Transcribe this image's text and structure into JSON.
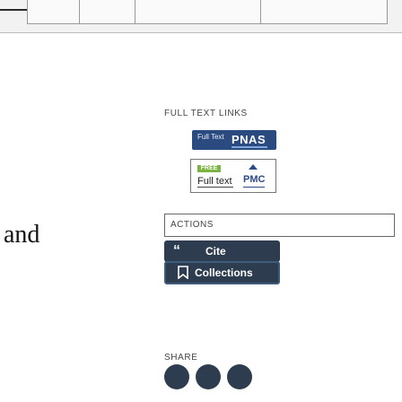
{
  "left_fragment": {
    "text": "and"
  },
  "full_text_links": {
    "heading": "FULL TEXT LINKS",
    "publisher_button": {
      "small_text": "Full Text",
      "brand": "PNAS"
    },
    "pmc_button": {
      "badge": "FREE",
      "label": "Full text",
      "brand": "PMC"
    }
  },
  "actions": {
    "label": "ACTIONS"
  },
  "buttons": {
    "cite": {
      "icon": "“",
      "label": "Cite"
    },
    "collections": {
      "label": "Collections"
    }
  },
  "share": {
    "label": "SHARE"
  },
  "colors": {
    "button_dark": "#2d3c4e",
    "pnas_blue": "#2b4b80",
    "free_green": "#7cb342"
  }
}
